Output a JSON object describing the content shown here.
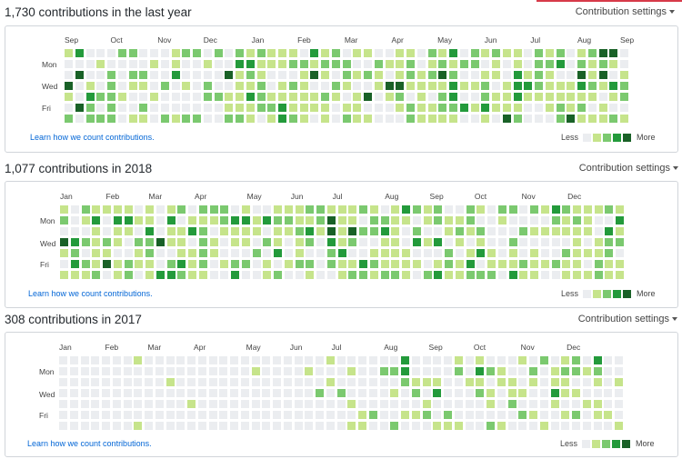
{
  "colors": {
    "l0": "#ebedf0",
    "l1": "#c6e48b",
    "l2": "#7bc96f",
    "l3": "#239a3b",
    "l4": "#196127"
  },
  "day_labels": [
    "Mon",
    "Wed",
    "Fri"
  ],
  "learn_link": "Learn how we count contributions.",
  "legend": {
    "less": "Less",
    "more": "More"
  },
  "sections": [
    {
      "title": "1,730 contributions in the last year",
      "settings_label": "Contribution settings",
      "months": [
        "Sep",
        "Oct",
        "Nov",
        "Dec",
        "Jan",
        "Feb",
        "Mar",
        "Apr",
        "May",
        "Jun",
        "Jul",
        "Aug",
        "Sep"
      ],
      "weeks": 53,
      "density": "high"
    },
    {
      "title": "1,077 contributions in 2018",
      "settings_label": "Contribution settings",
      "months": [
        "Jan",
        "Feb",
        "Mar",
        "Apr",
        "May",
        "Jun",
        "Jul",
        "Aug",
        "Sep",
        "Oct",
        "Nov",
        "Dec"
      ],
      "weeks": 53,
      "density": "medium"
    },
    {
      "title": "308 contributions in 2017",
      "settings_label": "Contribution settings",
      "months": [
        "Jan",
        "Feb",
        "Mar",
        "Apr",
        "May",
        "Jun",
        "Jul",
        "Aug",
        "Sep",
        "Oct",
        "Nov",
        "Dec"
      ],
      "weeks": 53,
      "density": "low"
    }
  ]
}
